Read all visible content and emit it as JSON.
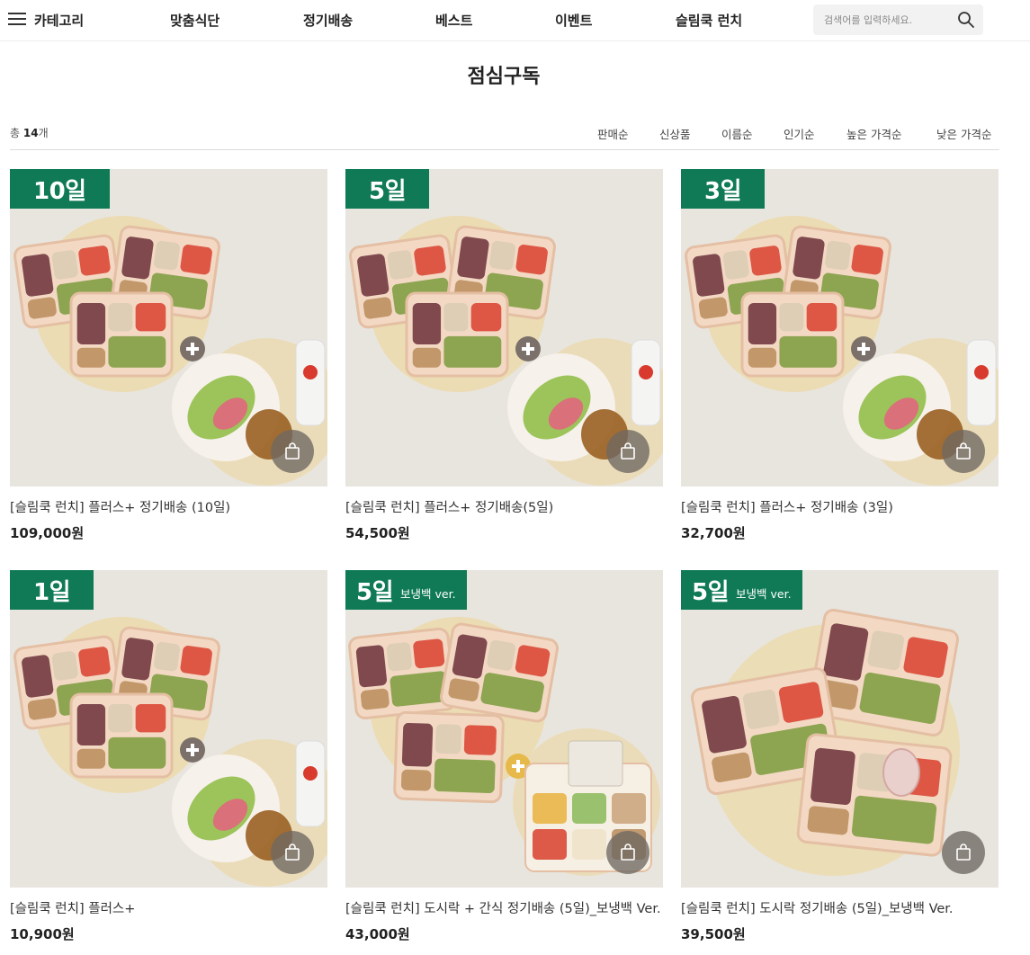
{
  "header": {
    "category_label": "카테고리",
    "nav": [
      "맞춤식단",
      "정기배송",
      "베스트",
      "이벤트",
      "슬림쿡 런치"
    ],
    "search_placeholder": "검색어를 입력하세요."
  },
  "page": {
    "title": "점심구독",
    "count_prefix": "총 ",
    "count_value": "14",
    "count_suffix": "개",
    "sort_options": [
      "판매순",
      "신상품",
      "이름순",
      "인기순",
      "높은 가격순",
      "낮은 가격순"
    ]
  },
  "products": [
    {
      "badge": "10일",
      "badge_sub": "",
      "name": "[슬림쿡 런치] 플러스+ 정기배송 (10일)",
      "price": "109,000원"
    },
    {
      "badge": "5일",
      "badge_sub": "",
      "name": "[슬림쿡 런치] 플러스+ 정기배송(5일)",
      "price": "54,500원"
    },
    {
      "badge": "3일",
      "badge_sub": "",
      "name": "[슬림쿡 런치] 플러스+ 정기배송 (3일)",
      "price": "32,700원"
    },
    {
      "badge": "1일",
      "badge_sub": "",
      "name": "[슬림쿡 런치] 플러스+",
      "price": "10,900원"
    },
    {
      "badge": "5일",
      "badge_sub": "보냉백 ver.",
      "name": "[슬림쿡 런치] 도시락 + 간식 정기배송 (5일)_보냉백 Ver.",
      "price": "43,000원"
    },
    {
      "badge": "5일",
      "badge_sub": "보냉백 ver.",
      "name": "[슬림쿡 런치] 도시락 정기배송 (5일)_보냉백 Ver.",
      "price": "39,500원"
    }
  ],
  "colors": {
    "badge_green": "#0f7a55",
    "plate": "#f3d9c4"
  }
}
